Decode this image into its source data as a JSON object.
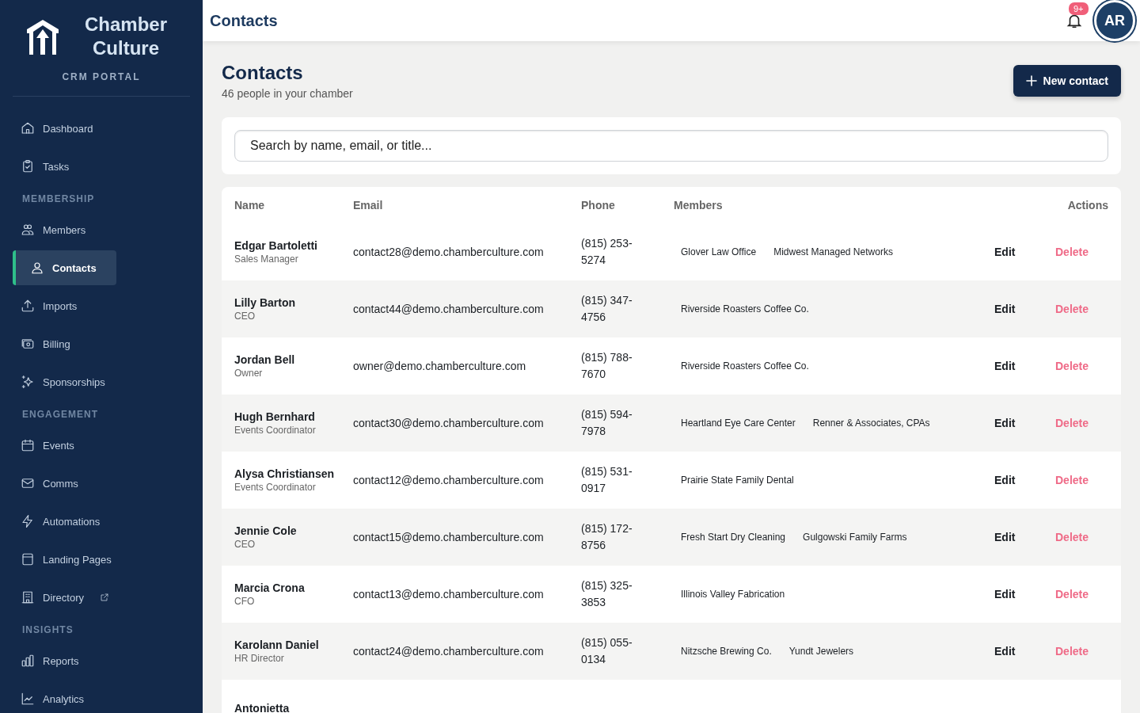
{
  "brand": {
    "name": "Chamber Culture",
    "subtitle": "CRM PORTAL"
  },
  "sidebar": {
    "sections": [
      {
        "items": [
          {
            "label": "Dashboard",
            "selected": false
          },
          {
            "label": "Tasks",
            "selected": false
          }
        ]
      },
      {
        "title": "MEMBERSHIP",
        "items": [
          {
            "label": "Members",
            "selected": false
          },
          {
            "label": "Contacts",
            "selected": true
          },
          {
            "label": "Imports",
            "selected": false
          },
          {
            "label": "Billing",
            "selected": false
          },
          {
            "label": "Sponsorships",
            "selected": false
          }
        ]
      },
      {
        "title": "ENGAGEMENT",
        "items": [
          {
            "label": "Events",
            "selected": false
          },
          {
            "label": "Comms",
            "selected": false
          },
          {
            "label": "Automations",
            "selected": false
          },
          {
            "label": "Landing Pages",
            "selected": false
          },
          {
            "label": "Directory",
            "selected": false,
            "external": true
          }
        ]
      },
      {
        "title": "INSIGHTS",
        "items": [
          {
            "label": "Reports",
            "selected": false
          },
          {
            "label": "Analytics",
            "selected": false
          }
        ]
      }
    ]
  },
  "topbar": {
    "title": "Contacts",
    "notifications": "9+",
    "avatar": "AR"
  },
  "page": {
    "title": "Contacts",
    "subtitle": "46 people in your chamber",
    "new_button": "New contact"
  },
  "search": {
    "placeholder": "Search by name, email, or title..."
  },
  "table": {
    "columns": [
      "Name",
      "Email",
      "Phone",
      "Members",
      "Actions"
    ],
    "rows": [
      {
        "name": "Edgar Bartoletti",
        "title": "Sales Manager",
        "email": "contact28@demo.chamberculture.com",
        "phone": "(815) 253-5274",
        "members": [
          "Glover Law Office",
          "Midwest Managed Networks"
        ],
        "edit": "Edit",
        "delete": "Delete"
      },
      {
        "name": "Lilly Barton",
        "title": "CEO",
        "email": "contact44@demo.chamberculture.com",
        "phone": "(815) 347-4756",
        "members": [
          "Riverside Roasters Coffee Co."
        ],
        "edit": "Edit",
        "delete": "Delete"
      },
      {
        "name": "Jordan Bell",
        "title": "Owner",
        "email": "owner@demo.chamberculture.com",
        "phone": "(815) 788-7670",
        "members": [
          "Riverside Roasters Coffee Co."
        ],
        "edit": "Edit",
        "delete": "Delete"
      },
      {
        "name": "Hugh Bernhard",
        "title": "Events Coordinator",
        "email": "contact30@demo.chamberculture.com",
        "phone": "(815) 594-7978",
        "members": [
          "Heartland Eye Care Center",
          "Renner & Associates, CPAs"
        ],
        "edit": "Edit",
        "delete": "Delete"
      },
      {
        "name": "Alysa Christiansen",
        "title": "Events Coordinator",
        "email": "contact12@demo.chamberculture.com",
        "phone": "(815) 531-0917",
        "members": [
          "Prairie State Family Dental"
        ],
        "edit": "Edit",
        "delete": "Delete"
      },
      {
        "name": "Jennie Cole",
        "title": "CEO",
        "email": "contact15@demo.chamberculture.com",
        "phone": "(815) 172-8756",
        "members": [
          "Fresh Start Dry Cleaning",
          "Gulgowski Family Farms"
        ],
        "edit": "Edit",
        "delete": "Delete"
      },
      {
        "name": "Marcia Crona",
        "title": "CFO",
        "email": "contact13@demo.chamberculture.com",
        "phone": "(815) 325-3853",
        "members": [
          "Illinois Valley Fabrication"
        ],
        "edit": "Edit",
        "delete": "Delete"
      },
      {
        "name": "Karolann Daniel",
        "title": "HR Director",
        "email": "contact24@demo.chamberculture.com",
        "phone": "(815) 055-0134",
        "members": [
          "Nitzsche Brewing Co.",
          "Yundt Jewelers"
        ],
        "edit": "Edit",
        "delete": "Delete"
      },
      {
        "name": "Antonietta"
      }
    ]
  }
}
